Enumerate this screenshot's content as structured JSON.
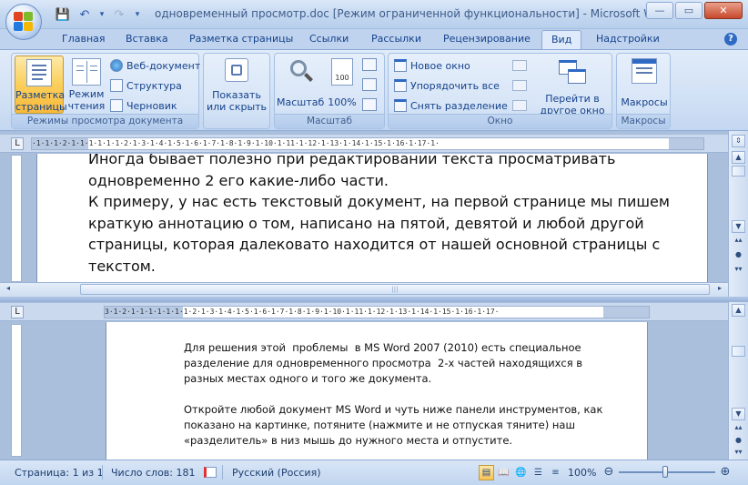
{
  "window": {
    "title": "одновременный просмотр.doc [Режим ограниченной функциональности] - Microsoft Word",
    "minimize_glyph": "—",
    "maximize_glyph": "▭",
    "close_glyph": "✕"
  },
  "qat": {
    "save_icon": "save-icon",
    "undo_icon": "undo-icon",
    "redo_icon": "redo-icon",
    "customize_icon": "customize-qat-icon",
    "separator": "|",
    "save_glyph": "💾",
    "undo_glyph": "↶",
    "dropdown_glyph": "▾",
    "redo_glyph": "↷",
    "customize_glyph": "▾"
  },
  "tabs": [
    "Главная",
    "Вставка",
    "Разметка страницы",
    "Ссылки",
    "Рассылки",
    "Рецензирование",
    "Вид",
    "Надстройки"
  ],
  "active_tab": "Вид",
  "help_glyph": "?",
  "ribbon": {
    "groups": {
      "views": {
        "label": "Режимы просмотра документа",
        "print_layout_line1": "Разметка",
        "print_layout_line2": "страницы",
        "reading_line1": "Режим",
        "reading_line2": "чтения",
        "web": "Веб-документ",
        "outline": "Структура",
        "draft": "Черновик"
      },
      "show_hide": {
        "label_line1": "Показать",
        "label_line2": "или скрыть"
      },
      "zoom": {
        "label": "Масштаб",
        "zoom_button": "Масштаб",
        "percent_button": "100%",
        "page_icon_text": "100"
      },
      "window": {
        "label": "Окно",
        "new_window": "Новое окно",
        "arrange_all": "Упорядочить все",
        "remove_split": "Снять разделение",
        "switch_line1": "Перейти в",
        "switch_line2": "другое окно"
      },
      "macros": {
        "label": "Макросы",
        "button": "Макросы"
      }
    }
  },
  "ruler": {
    "tab_glyph": "L",
    "top_numbers": "·1·1·1·2·1·1·1·1·1·1·2·1·3·1·4·1·5·1·6·1·7·1·8·1·9·1·10·1·11·1·12·1·13·1·14·1·15·1·16·1·17·1·",
    "bottom_numbers": "3·1·2·1·1·1·1·1·1·1·2·1·3·1·4·1·5·1·6·1·7·1·8·1·9·1·10·1·11·1·12·1·13·1·14·1·15·1·16·1·17·"
  },
  "scroll_glyphs": {
    "up": "▲",
    "down": "▼",
    "prev_page": "▴▴",
    "browse": "●",
    "next_page": "▾▾",
    "split_handle": "⇕",
    "left": "◂",
    "right": "▸",
    "grip": "|||"
  },
  "top_pane": {
    "text": "Иногда бывает полезно при редактировании текста просматривать\nодновременно 2 его какие-либо части.\nК примеру, у нас есть текстовый документ, на первой странице мы пишем\nкраткую аннотацию о том, написано на пятой, девятой и любой другой\nстраницы, которая далековато находится от нашей основной страницы с\nтекстом."
  },
  "bottom_pane": {
    "paragraph1": "Для решения этой  проблемы  в MS Word 2007 (2010) есть специальное\nразделение для одновременного просмотра  2-х частей находящихся в\nразных местах одного и того же документа.",
    "paragraph2": "Откройте любой документ MS Word и чуть ниже панели инструментов, как\nпоказано на картинке, потяните (нажмите и не отпуская тяните) наш\n«разделитель» в низ мышь до нужного места и отпустите."
  },
  "status": {
    "page": "Страница: 1 из 1",
    "words": "Число слов: 181",
    "language": "Русский (Россия)",
    "zoom": "100%",
    "zoom_minus": "⊖",
    "zoom_plus": "⊕",
    "view_glyphs": [
      "▤",
      "📖",
      "🌐",
      "☰",
      "≡"
    ]
  },
  "colors": {
    "accent": "#15428b",
    "active_button": "#fbcf5b",
    "ribbon_bg": "#d1e1f5"
  }
}
